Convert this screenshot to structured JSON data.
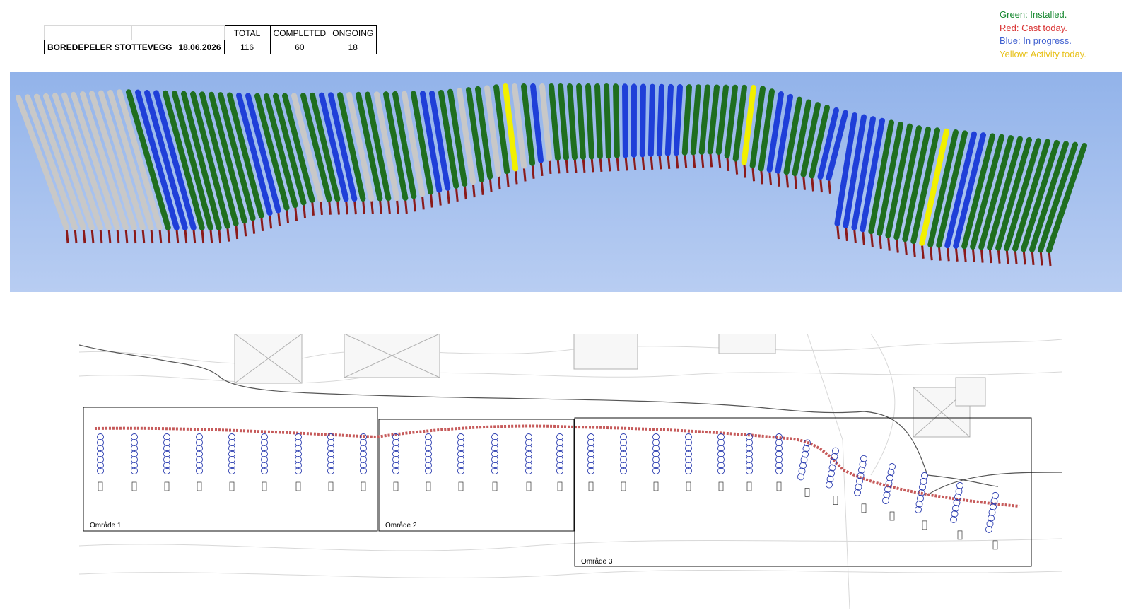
{
  "summary": {
    "headers": [
      "TOTAL",
      "COMPLETED",
      "ONGOING"
    ],
    "label": "BOREDEPELER STOTTEVEGG",
    "date": "18.06.2026",
    "total": "116",
    "completed": "60",
    "ongoing": "18"
  },
  "legend": [
    {
      "text": "Green: Installed.",
      "color": "#1a8a33"
    },
    {
      "text": "Red: Cast today.",
      "color": "#d93434"
    },
    {
      "text": "Blue: In progress.",
      "color": "#3e5fcf"
    },
    {
      "text": "Yellow: Activity today.",
      "color": "#e8c21c"
    }
  ],
  "colors": {
    "installed": "#1f6e1f",
    "in_progress": "#1f3fd8",
    "activity_today": "#f2f000",
    "not_started": "#c8c8c8",
    "rebar": "#8b1a1a",
    "background_top": "#92b3ea",
    "background_bottom": "#b8cdf2"
  },
  "piles": {
    "status_sequence": "GGGGGGGGGGGGGBBBGGGGGGGGBBGGGGGGGBBGGGGGGGGGBBGGGGGGGYGGBGGGGGGGGGBBBBBBBGGGGGGGYGGBBGGGGBBBBBBGGGGGGYGGBBGGGGGGGGGGG"
  },
  "plan": {
    "areas": [
      {
        "label": "Område 1"
      },
      {
        "label": "Område 2"
      },
      {
        "label": "Område 3"
      }
    ]
  }
}
